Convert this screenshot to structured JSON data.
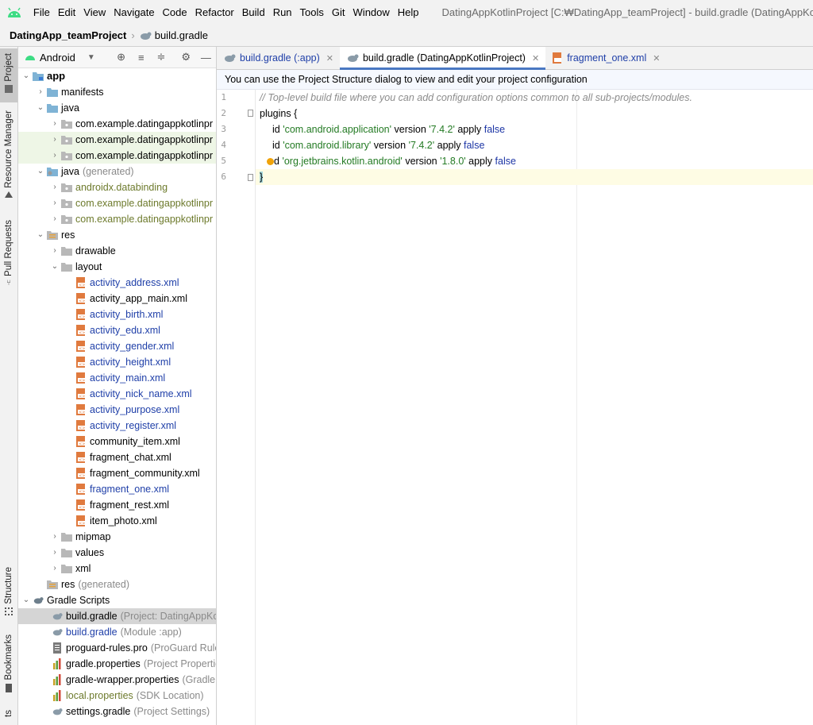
{
  "menubar": {
    "items": [
      "File",
      "Edit",
      "View",
      "Navigate",
      "Code",
      "Refactor",
      "Build",
      "Run",
      "Tools",
      "Git",
      "Window",
      "Help"
    ],
    "window_title": "DatingAppKotlinProject [C:₩DatingApp_teamProject] - build.gradle (DatingAppKotlinProject)"
  },
  "breadcrumb": {
    "project": "DatingApp_teamProject",
    "file": "build.gradle"
  },
  "side_tabs": [
    "Project",
    "Resource Manager",
    "Pull Requests",
    "Structure",
    "Bookmarks",
    "ts"
  ],
  "project_panel": {
    "view_mode": "Android",
    "tree": [
      {
        "label": "app",
        "bold": true
      },
      {
        "label": "manifests"
      },
      {
        "label": "java"
      },
      {
        "label": "com.example.datingappkotlinpr"
      },
      {
        "label": "com.example.datingappkotlinpr"
      },
      {
        "label": "com.example.datingappkotlinpr"
      },
      {
        "label": "java",
        "hint": "(generated)"
      },
      {
        "label": "androidx.databinding"
      },
      {
        "label": "com.example.datingappkotlinpr"
      },
      {
        "label": "com.example.datingappkotlinpr"
      },
      {
        "label": "res"
      },
      {
        "label": "drawable"
      },
      {
        "label": "layout"
      },
      {
        "label": "activity_address.xml"
      },
      {
        "label": "activity_app_main.xml"
      },
      {
        "label": "activity_birth.xml"
      },
      {
        "label": "activity_edu.xml"
      },
      {
        "label": "activity_gender.xml"
      },
      {
        "label": "activity_height.xml"
      },
      {
        "label": "activity_main.xml"
      },
      {
        "label": "activity_nick_name.xml"
      },
      {
        "label": "activity_purpose.xml"
      },
      {
        "label": "activity_register.xml"
      },
      {
        "label": "community_item.xml"
      },
      {
        "label": "fragment_chat.xml"
      },
      {
        "label": "fragment_community.xml"
      },
      {
        "label": "fragment_one.xml"
      },
      {
        "label": "fragment_rest.xml"
      },
      {
        "label": "item_photo.xml"
      },
      {
        "label": "mipmap"
      },
      {
        "label": "values"
      },
      {
        "label": "xml"
      },
      {
        "label": "res",
        "hint": "(generated)"
      },
      {
        "label": "Gradle Scripts"
      },
      {
        "label": "build.gradle",
        "hint": "(Project: DatingAppKotl"
      },
      {
        "label": "build.gradle",
        "hint": "(Module :app)"
      },
      {
        "label": "proguard-rules.pro",
        "hint": "(ProGuard Rules"
      },
      {
        "label": "gradle.properties",
        "hint": "(Project Properties"
      },
      {
        "label": "gradle-wrapper.properties",
        "hint": "(Gradle V"
      },
      {
        "label": "local.properties",
        "hint": "(SDK Location)"
      },
      {
        "label": "settings.gradle",
        "hint": "(Project Settings)"
      }
    ]
  },
  "editor": {
    "tabs": [
      "build.gradle (:app)",
      "build.gradle (DatingAppKotlinProject)",
      "fragment_one.xml"
    ],
    "banner": "You can use the Project Structure dialog to view and edit your project configuration",
    "line_numbers": [
      "1",
      "2",
      "3",
      "4",
      "5",
      "6"
    ],
    "code": {
      "line1": "// Top-level build file where you can add configuration options common to all sub-projects/modules.",
      "plugins_kw": "plugins",
      "open_brace": "{",
      "close_brace": "}",
      "id_kw": "id",
      "id_kw_tail": "d",
      "version_kw": "version",
      "apply_kw": "apply",
      "false_kw": "false",
      "p1_name": "'com.android.application'",
      "p1_ver": "'7.4.2'",
      "p2_name": "'com.android.library'",
      "p2_ver": "'7.4.2'",
      "p3_name": "'org.jetbrains.kotlin.android'",
      "p3_ver": "'1.8.0'"
    }
  },
  "colors": {
    "accent": "#4a78c2",
    "android_green": "#3ddc84",
    "folder_blue": "#7fb3d5",
    "xml_orange": "#e07a3e",
    "current_line": "#fefce4",
    "brace_match": "#a6d9dc"
  }
}
